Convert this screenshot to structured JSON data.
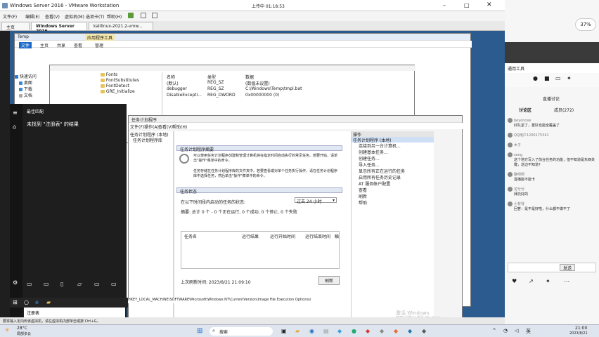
{
  "vmware": {
    "title": "Windows Server 2016 - VMware Workstation",
    "menu": [
      "文件(F)",
      "编辑(E)",
      "查看(V)",
      "虚拟机(M)",
      "选项卡(T)",
      "帮助(H)"
    ],
    "tabs": [
      "主页",
      "Windows Server 2016",
      "kalilinux-2021.2-vmw..."
    ],
    "upload_status": "上传中 01:18:53"
  },
  "explorer": {
    "title": "Temp",
    "ribbon": [
      "文件",
      "主页",
      "共享",
      "查看",
      "管理"
    ],
    "tool_tab": "应用程序工具",
    "nav": [
      "快速访问",
      "桌面",
      "下载",
      "文档"
    ],
    "reg_keys": [
      "Fonts",
      "FontSubstitutes",
      "FontDetect",
      "GRE_Initialize"
    ],
    "columns": [
      "名称",
      "类型",
      "数据"
    ],
    "rows": [
      {
        "name": "(默认)",
        "type": "REG_SZ",
        "data": "(数值未设置)"
      },
      {
        "name": "debugger",
        "type": "REG_SZ",
        "data": "C:\\Windows\\Temp\\tmpl.bat"
      },
      {
        "name": "DisableExcepti...",
        "type": "REG_DWORD",
        "data": "0x00000000 (0)"
      }
    ],
    "statusbar": "HKEY_LOCAL_MACHINE\\SOFTWARE\\Microsoft\\Windows NT\\CurrentVersion\\Image File Execution Options\\iexplore.exe",
    "items": [
      ".exe",
      ".exe",
      ".exe"
    ]
  },
  "scheduler": {
    "title": "任务计划程序",
    "menu": [
      "文件(F)",
      "操作(A)",
      "查看(V)",
      "帮助(H)"
    ],
    "tree": [
      "任务计划程序 (本地)",
      "任务计划程序库"
    ],
    "overview_header": "任务计划程序摘要",
    "overview_text1": "可以使用任务计划程序创建和管理计算机将在指定时间自动执行的常见任务。若要开始，请单击\"操作\"菜单中的命令。",
    "overview_text2": "任务存储在任务计划程序库的文件夹中。若要查看或对单个任务执行操作，请在任务计划程序库中选择任务，然后单击\"操作\"菜单中的命令。",
    "status_header": "任务状态",
    "status_label": "在以下时间段内启动的任务的状态:",
    "status_range": "过去 24 小时",
    "summary": "摘要: 总计 0 个 - 0 个正在运行, 0 个成功, 0 个停止, 0 个失败",
    "table_cols": [
      "任务名",
      "运行结果",
      "运行开始时间",
      "运行结束时间",
      "触"
    ],
    "refresh_time": "上次刷新时间: 2023/8/21 21:09:10",
    "refresh_btn": "刷新",
    "actions_header": "操作",
    "actions_selected": "任务计划程序 (本地)",
    "actions": [
      "连接到另一台计算机...",
      "创建基本任务...",
      "创建任务...",
      "导入任务...",
      "显示所有正在运行的任务",
      "启用所有任务历史记录",
      "AT 服务帐户配置",
      "查看",
      "刷新",
      "帮助"
    ],
    "watermark1": "激活 Windows",
    "watermark2": "转到\"设置\"以激活 Windows。"
  },
  "startmenu": {
    "header": "最佳匹配",
    "no_result": "未找到 \"注册表\" 的结果",
    "search_value": "注册表"
  },
  "chat": {
    "tool_label": "通用工具",
    "live_label": "直播讨论",
    "tab": "讨论区",
    "count": "成员(272)",
    "messages": [
      {
        "user": "beyoncee",
        "text": "红队足了，置队也能全覆盖了"
      },
      {
        "user": "QQ用户1200175341",
        "text": ""
      },
      {
        "user": "木子",
        "text": ""
      },
      {
        "user": "song",
        "text": "这个地方写入了前台任务的功能，但不知道是东西关键，这边不知道?"
      },
      {
        "user": "聊呗呗",
        "text": "直播能不能卡"
      },
      {
        "user": "花兮兮",
        "text": "拜托好的"
      },
      {
        "user": "小背背",
        "text": "回答：是不是好啦，什么都不做不了"
      }
    ],
    "send_label": "发送"
  },
  "badge": "37%",
  "taskbar": {
    "weather": "28°C",
    "weather_sub": "局部多云",
    "search_placeholder": "搜索",
    "ime": "英",
    "time": "21:00",
    "date": "2023/8/21"
  },
  "vm_status": "要将输入定向到该虚拟机，请在虚拟机内部单击或按 Ctrl+G。"
}
